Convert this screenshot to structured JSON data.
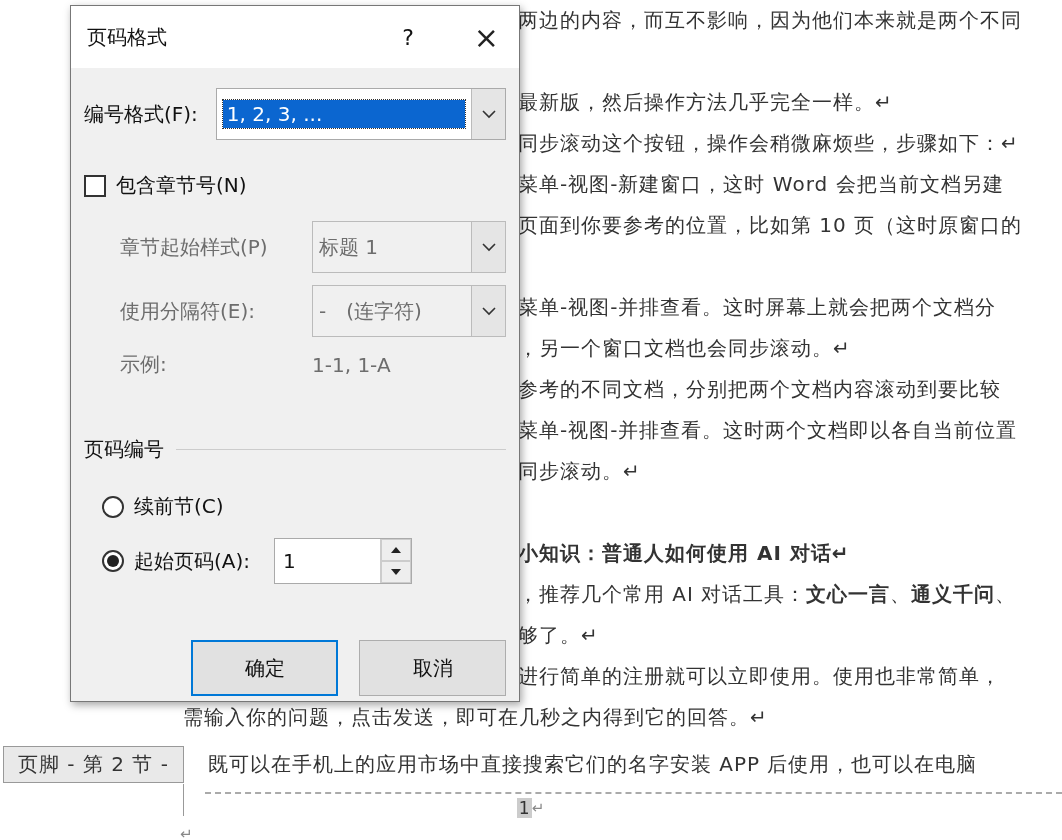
{
  "document": {
    "lines": [
      {
        "kind": "body",
        "text": "两边的内容，而互不影响，因为他们本来就是两个不同"
      },
      {
        "kind": "blank"
      },
      {
        "kind": "body",
        "text": "最新版，然后操作方法几乎完全一样。↵"
      },
      {
        "kind": "body",
        "text": "同步滚动这个按钮，操作会稍微麻烦些，步骤如下：↵"
      },
      {
        "kind": "body",
        "text": "菜单-视图-新建窗口，这时 Word 会把当前文档另建"
      },
      {
        "kind": "body",
        "text": "页面到你要参考的位置，比如第 10 页（这时原窗口的"
      },
      {
        "kind": "blank"
      },
      {
        "kind": "body",
        "text": "菜单-视图-并排查看。这时屏幕上就会把两个文档分"
      },
      {
        "kind": "body",
        "text": "，另一个窗口文档也会同步滚动。↵"
      },
      {
        "kind": "body",
        "text": "参考的不同文档，分别把两个文档内容滚动到要比较"
      },
      {
        "kind": "body",
        "text": "菜单-视图-并排查看。这时两个文档即以各自当前位置"
      },
      {
        "kind": "body",
        "text": "同步滚动。↵"
      },
      {
        "kind": "blank"
      },
      {
        "kind": "heading",
        "text": "小知识：普通人如何使用 AI 对话↵"
      },
      {
        "kind": "body",
        "text": "，推荐几个常用 AI 对话工具：**文心一言**、**通义千问**、"
      },
      {
        "kind": "body",
        "text": "够了。↵"
      },
      {
        "kind": "body",
        "text": "进行简单的注册就可以立即使用。使用也非常简单，"
      },
      {
        "kind": "wide",
        "text": "需输入你的问题，点击发送，即可在几秒之内得到它的回答。↵"
      }
    ],
    "footer": {
      "tag": "页脚 - 第 2 节 -",
      "text": "既可以在手机上的应用市场中直接搜索它们的名字安装 APP 后使用，也可以在电脑",
      "page_number": "1",
      "page_mark": "↵",
      "end_mark": "↵"
    }
  },
  "dialog": {
    "title": "页码格式",
    "help": "?",
    "close": "×",
    "number_format": {
      "label": "编号格式(F):",
      "value": "1, 2, 3, ..."
    },
    "include_chapter": {
      "label": "包含章节号(N)",
      "checked": false
    },
    "chapter_style": {
      "label": "章节起始样式(P)",
      "value": "标题 1",
      "disabled": true
    },
    "separator": {
      "label": "使用分隔符(E):",
      "value": "-　(连字符)",
      "disabled": true
    },
    "example": {
      "label": "示例:",
      "value": "1-1, 1-A",
      "disabled": true
    },
    "numbering": {
      "title": "页码编号",
      "options": [
        {
          "label": "续前节(C)",
          "selected": false
        },
        {
          "label": "起始页码(A):",
          "selected": true
        }
      ],
      "start_at": "1"
    },
    "buttons": [
      {
        "label": "确定",
        "default": true
      },
      {
        "label": "取消",
        "default": false
      }
    ]
  }
}
